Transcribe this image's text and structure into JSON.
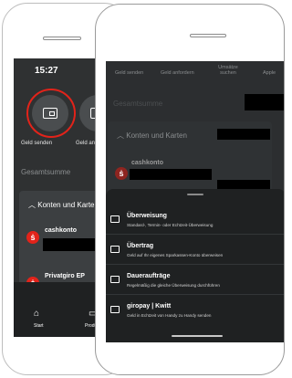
{
  "back_screen": {
    "time": "15:27",
    "quick_actions": [
      {
        "label": "Geld senden",
        "icon": "card-send-icon"
      },
      {
        "label": "Geld anf",
        "icon": "card-request-icon"
      }
    ],
    "total_label": "Gesamtsumme",
    "accounts_header": "Konten und Karte",
    "accounts": [
      {
        "name": "cashkonto"
      },
      {
        "name": "Privatgiro EP"
      }
    ],
    "nav": [
      {
        "label": "Start",
        "icon": "home-icon"
      },
      {
        "label": "Produkte",
        "icon": "products-icon"
      }
    ]
  },
  "front_screen": {
    "tabs": [
      "Geld senden",
      "Geld anfordern",
      "Umsätze suchen",
      "Apple"
    ],
    "total_label": "Gesamtsumme",
    "accounts_header": "Konten und Karten",
    "account_name": "cashkonto",
    "sheet_options": [
      {
        "title": "Überweisung",
        "subtitle": "Standard-, Termin- oder Echtzeit-Überweisung",
        "icon": "transfer-card-icon"
      },
      {
        "title": "Übertrag",
        "subtitle": "Geld auf Ihr eigenes Sparkassen-Konto überweisen",
        "icon": "internal-transfer-icon"
      },
      {
        "title": "Daueraufträge",
        "subtitle": "Regelmäßig die gleiche Überweisung durchführen",
        "icon": "standing-order-icon"
      },
      {
        "title": "giropay | Kwitt",
        "subtitle": "Geld in Echtzeit von Handy zu Handy senden",
        "icon": "giropay-icon"
      }
    ]
  },
  "colors": {
    "accent": "#e2231a",
    "screen_bg": "#2f3132",
    "sheet_bg": "#1f2122"
  }
}
